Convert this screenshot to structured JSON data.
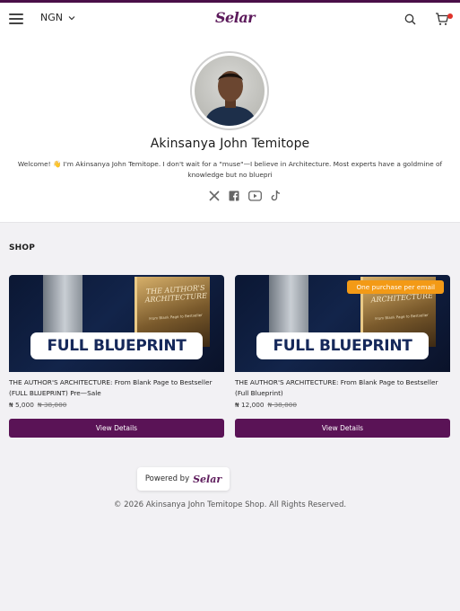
{
  "header": {
    "currency": "NGN",
    "logo": "Selar",
    "cart_has_items": true
  },
  "profile": {
    "name": "Akinsanya John Temitope",
    "bio": "Welcome! 👋 I'm Akinsanya John Temitope. I don't wait for a \"muse\"—I believe in Architecture. Most experts have a goldmine of knowledge but no bluepri",
    "socials": [
      "x-icon",
      "facebook-icon",
      "youtube-icon",
      "tiktok-icon"
    ]
  },
  "shop": {
    "title": "SHOP",
    "products": [
      {
        "cover_text": "FULL BLUEPRINT",
        "book_title": "THE AUTHOR'S ARCHITECTURE",
        "book_subtitle": "From Blank Page to Bestseller",
        "title": "THE AUTHOR'S ARCHITECTURE: From Blank Page to Bestseller (FULL BLUEPRINT) Pre—Sale",
        "price": "₦ 5,000",
        "old_price": "₦ 38,000",
        "badge": "",
        "button": "View Details"
      },
      {
        "cover_text": "FULL BLUEPRINT",
        "book_title": "THE AUTHOR'S ARCHITECTURE",
        "book_subtitle": "From Blank Page to Bestseller",
        "title": "THE AUTHOR'S ARCHITECTURE: From Blank Page to Bestseller (Full Blueprint)",
        "price": "₦ 12,000",
        "old_price": "₦ 38,000",
        "badge": "One purchase per email",
        "button": "View Details"
      }
    ]
  },
  "powered_by": {
    "label": "Powered by",
    "logo": "Selar"
  },
  "footer": "© 2026 Akinsanya John Temitope Shop. All Rights Reserved.",
  "colors": {
    "brand": "#5a1356",
    "badge": "#f39a16",
    "cart_dot": "#e0322b"
  }
}
